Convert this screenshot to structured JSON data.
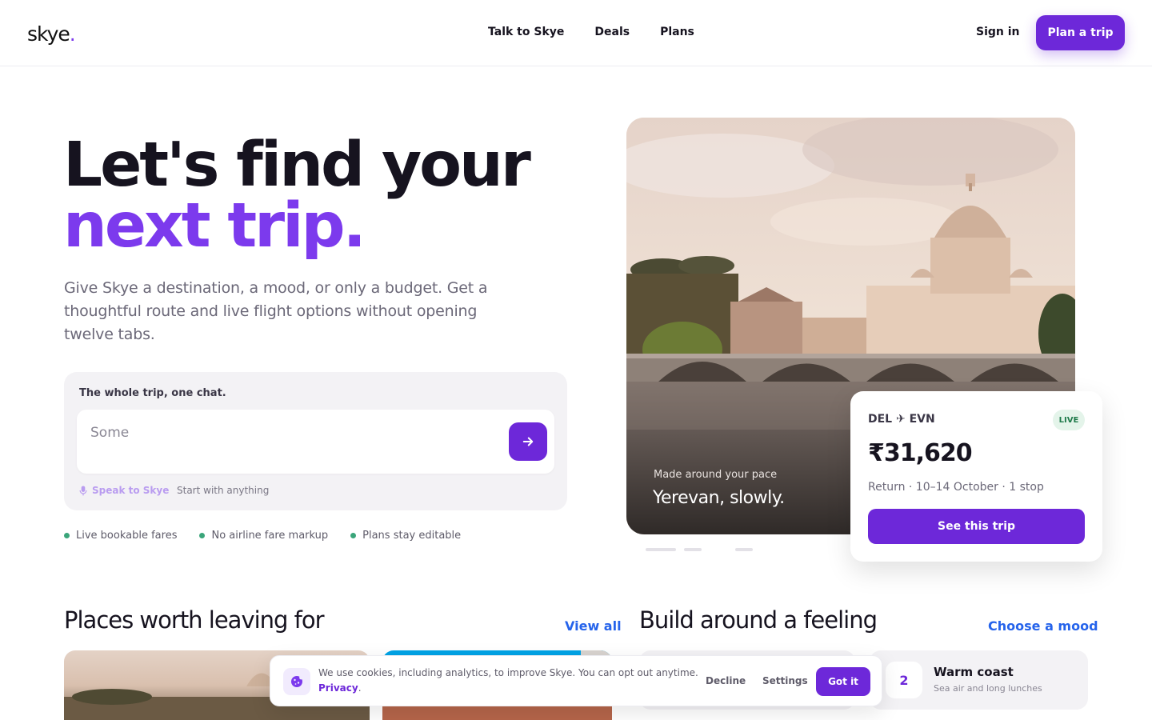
{
  "header": {
    "logo": "skye",
    "logo_dot": ".",
    "nav": [
      "Talk to Skye",
      "Deals",
      "Plans"
    ],
    "sign_in": "Sign in",
    "cta": "Plan a trip"
  },
  "hero": {
    "title_line1": "Let's find your",
    "title_line2": "next trip.",
    "subtitle": "Give Skye a destination, a mood, or only a budget. Get a thoughtful route and live flight options without opening twelve tabs.",
    "chat": {
      "label": "The whole trip, one chat.",
      "input_value": "Some",
      "speak": "Speak to Skye",
      "hint": "Start with anything"
    },
    "features": [
      "Live bookable fares",
      "No airline fare markup",
      "Plans stay editable"
    ]
  },
  "showcase": {
    "caption_small": "Made around your pace",
    "caption_large": "Yerevan, slowly.",
    "trip": {
      "route": "DEL ✈ EVN",
      "badge": "LIVE",
      "price": "₹31,620",
      "meta": "Return · 10–14 October · 1 stop",
      "cta": "See this trip"
    }
  },
  "places": {
    "title": "Places worth leaving for",
    "link": "View all"
  },
  "moods": {
    "title": "Build around a feeling",
    "link": "Choose a mood",
    "items": [
      {
        "num": "2",
        "title": "Warm coast",
        "sub": "Sea air and long lunches"
      }
    ]
  },
  "cookie": {
    "text": "We use cookies, including analytics, to improve Skye. You can opt out anytime.",
    "link": "Privacy",
    "period": ".",
    "decline": "Decline",
    "settings": "Settings",
    "accept": "Got it"
  },
  "colors": {
    "accent": "#6d28d9",
    "accent_text": "#7c3aed",
    "link": "#2563eb",
    "live_green": "#3aa57a"
  }
}
